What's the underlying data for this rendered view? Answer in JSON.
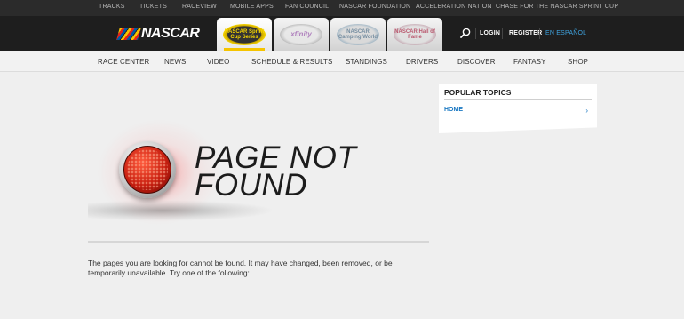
{
  "topbar": {
    "links": [
      "TRACKS",
      "TICKETS",
      "RACEVIEW",
      "MOBILE APPS",
      "FAN COUNCIL",
      "NASCAR FOUNDATION",
      "ACCELERATION NATION",
      "CHASE FOR THE NASCAR SPRINT CUP"
    ]
  },
  "header": {
    "logo_text": "NASCAR",
    "series_tabs": [
      {
        "label": "NASCAR Sprint Cup Series",
        "icon": "sprint-cup-logo",
        "active": true
      },
      {
        "label": "xfinity",
        "icon": "xfinity-series-logo",
        "active": false
      },
      {
        "label": "NASCAR Camping World",
        "icon": "camping-world-series-logo",
        "active": false
      },
      {
        "label": "NASCAR Hall of Fame",
        "icon": "hall-of-fame-logo",
        "active": false
      }
    ],
    "search_icon": "magnifier-icon",
    "login": "LOGIN",
    "register": "REGISTER",
    "language": "EN ESPAÑOL"
  },
  "nav": {
    "items": [
      "RACE CENTER",
      "NEWS",
      "VIDEO",
      "SCHEDULE & RESULTS",
      "STANDINGS",
      "DRIVERS",
      "DISCOVER",
      "FANTASY",
      "SHOP"
    ]
  },
  "error": {
    "title": "PAGE NOT\nFOUND",
    "message": "The pages you are looking for cannot be found. It may have changed, been removed, or be temporarily unavailable. Try one of the following:",
    "icon": "red-warning-light-icon"
  },
  "sidebar": {
    "title": "POPULAR TOPICS",
    "items": [
      {
        "label": "HOME",
        "icon": "chevron-right-icon"
      }
    ]
  },
  "colors": {
    "topbar_bg": "#2b2b2b",
    "header_bg": "#1e1e1e",
    "accent_blue": "#1a78c2",
    "active_tab_underline": "#f5c400",
    "page_bg": "#efefef"
  }
}
